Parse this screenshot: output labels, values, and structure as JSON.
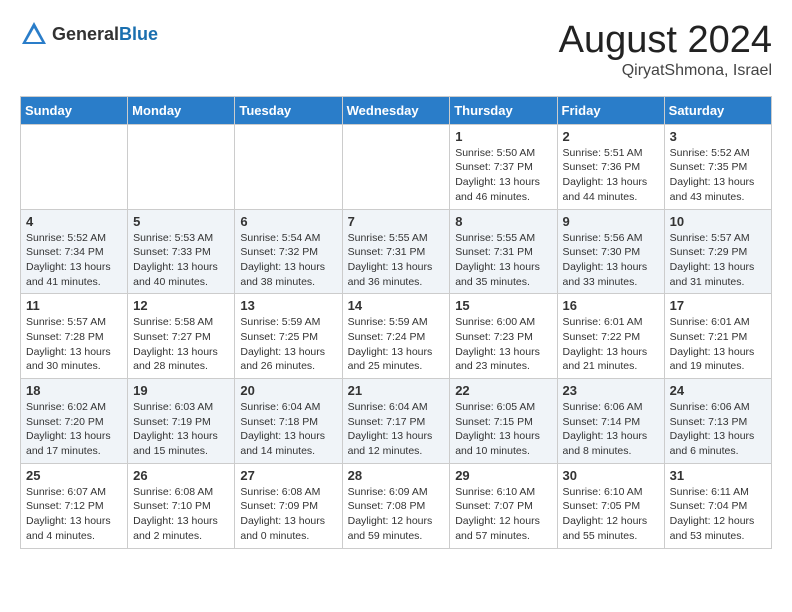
{
  "header": {
    "logo_general": "General",
    "logo_blue": "Blue",
    "title": "August 2024",
    "location": "QiryatShmona, Israel"
  },
  "weekdays": [
    "Sunday",
    "Monday",
    "Tuesday",
    "Wednesday",
    "Thursday",
    "Friday",
    "Saturday"
  ],
  "weeks": [
    [
      {
        "day": "",
        "sunrise": "",
        "sunset": "",
        "daylight": ""
      },
      {
        "day": "",
        "sunrise": "",
        "sunset": "",
        "daylight": ""
      },
      {
        "day": "",
        "sunrise": "",
        "sunset": "",
        "daylight": ""
      },
      {
        "day": "",
        "sunrise": "",
        "sunset": "",
        "daylight": ""
      },
      {
        "day": "1",
        "sunrise": "Sunrise: 5:50 AM",
        "sunset": "Sunset: 7:37 PM",
        "daylight": "Daylight: 13 hours and 46 minutes."
      },
      {
        "day": "2",
        "sunrise": "Sunrise: 5:51 AM",
        "sunset": "Sunset: 7:36 PM",
        "daylight": "Daylight: 13 hours and 44 minutes."
      },
      {
        "day": "3",
        "sunrise": "Sunrise: 5:52 AM",
        "sunset": "Sunset: 7:35 PM",
        "daylight": "Daylight: 13 hours and 43 minutes."
      }
    ],
    [
      {
        "day": "4",
        "sunrise": "Sunrise: 5:52 AM",
        "sunset": "Sunset: 7:34 PM",
        "daylight": "Daylight: 13 hours and 41 minutes."
      },
      {
        "day": "5",
        "sunrise": "Sunrise: 5:53 AM",
        "sunset": "Sunset: 7:33 PM",
        "daylight": "Daylight: 13 hours and 40 minutes."
      },
      {
        "day": "6",
        "sunrise": "Sunrise: 5:54 AM",
        "sunset": "Sunset: 7:32 PM",
        "daylight": "Daylight: 13 hours and 38 minutes."
      },
      {
        "day": "7",
        "sunrise": "Sunrise: 5:55 AM",
        "sunset": "Sunset: 7:31 PM",
        "daylight": "Daylight: 13 hours and 36 minutes."
      },
      {
        "day": "8",
        "sunrise": "Sunrise: 5:55 AM",
        "sunset": "Sunset: 7:31 PM",
        "daylight": "Daylight: 13 hours and 35 minutes."
      },
      {
        "day": "9",
        "sunrise": "Sunrise: 5:56 AM",
        "sunset": "Sunset: 7:30 PM",
        "daylight": "Daylight: 13 hours and 33 minutes."
      },
      {
        "day": "10",
        "sunrise": "Sunrise: 5:57 AM",
        "sunset": "Sunset: 7:29 PM",
        "daylight": "Daylight: 13 hours and 31 minutes."
      }
    ],
    [
      {
        "day": "11",
        "sunrise": "Sunrise: 5:57 AM",
        "sunset": "Sunset: 7:28 PM",
        "daylight": "Daylight: 13 hours and 30 minutes."
      },
      {
        "day": "12",
        "sunrise": "Sunrise: 5:58 AM",
        "sunset": "Sunset: 7:27 PM",
        "daylight": "Daylight: 13 hours and 28 minutes."
      },
      {
        "day": "13",
        "sunrise": "Sunrise: 5:59 AM",
        "sunset": "Sunset: 7:25 PM",
        "daylight": "Daylight: 13 hours and 26 minutes."
      },
      {
        "day": "14",
        "sunrise": "Sunrise: 5:59 AM",
        "sunset": "Sunset: 7:24 PM",
        "daylight": "Daylight: 13 hours and 25 minutes."
      },
      {
        "day": "15",
        "sunrise": "Sunrise: 6:00 AM",
        "sunset": "Sunset: 7:23 PM",
        "daylight": "Daylight: 13 hours and 23 minutes."
      },
      {
        "day": "16",
        "sunrise": "Sunrise: 6:01 AM",
        "sunset": "Sunset: 7:22 PM",
        "daylight": "Daylight: 13 hours and 21 minutes."
      },
      {
        "day": "17",
        "sunrise": "Sunrise: 6:01 AM",
        "sunset": "Sunset: 7:21 PM",
        "daylight": "Daylight: 13 hours and 19 minutes."
      }
    ],
    [
      {
        "day": "18",
        "sunrise": "Sunrise: 6:02 AM",
        "sunset": "Sunset: 7:20 PM",
        "daylight": "Daylight: 13 hours and 17 minutes."
      },
      {
        "day": "19",
        "sunrise": "Sunrise: 6:03 AM",
        "sunset": "Sunset: 7:19 PM",
        "daylight": "Daylight: 13 hours and 15 minutes."
      },
      {
        "day": "20",
        "sunrise": "Sunrise: 6:04 AM",
        "sunset": "Sunset: 7:18 PM",
        "daylight": "Daylight: 13 hours and 14 minutes."
      },
      {
        "day": "21",
        "sunrise": "Sunrise: 6:04 AM",
        "sunset": "Sunset: 7:17 PM",
        "daylight": "Daylight: 13 hours and 12 minutes."
      },
      {
        "day": "22",
        "sunrise": "Sunrise: 6:05 AM",
        "sunset": "Sunset: 7:15 PM",
        "daylight": "Daylight: 13 hours and 10 minutes."
      },
      {
        "day": "23",
        "sunrise": "Sunrise: 6:06 AM",
        "sunset": "Sunset: 7:14 PM",
        "daylight": "Daylight: 13 hours and 8 minutes."
      },
      {
        "day": "24",
        "sunrise": "Sunrise: 6:06 AM",
        "sunset": "Sunset: 7:13 PM",
        "daylight": "Daylight: 13 hours and 6 minutes."
      }
    ],
    [
      {
        "day": "25",
        "sunrise": "Sunrise: 6:07 AM",
        "sunset": "Sunset: 7:12 PM",
        "daylight": "Daylight: 13 hours and 4 minutes."
      },
      {
        "day": "26",
        "sunrise": "Sunrise: 6:08 AM",
        "sunset": "Sunset: 7:10 PM",
        "daylight": "Daylight: 13 hours and 2 minutes."
      },
      {
        "day": "27",
        "sunrise": "Sunrise: 6:08 AM",
        "sunset": "Sunset: 7:09 PM",
        "daylight": "Daylight: 13 hours and 0 minutes."
      },
      {
        "day": "28",
        "sunrise": "Sunrise: 6:09 AM",
        "sunset": "Sunset: 7:08 PM",
        "daylight": "Daylight: 12 hours and 59 minutes."
      },
      {
        "day": "29",
        "sunrise": "Sunrise: 6:10 AM",
        "sunset": "Sunset: 7:07 PM",
        "daylight": "Daylight: 12 hours and 57 minutes."
      },
      {
        "day": "30",
        "sunrise": "Sunrise: 6:10 AM",
        "sunset": "Sunset: 7:05 PM",
        "daylight": "Daylight: 12 hours and 55 minutes."
      },
      {
        "day": "31",
        "sunrise": "Sunrise: 6:11 AM",
        "sunset": "Sunset: 7:04 PM",
        "daylight": "Daylight: 12 hours and 53 minutes."
      }
    ]
  ]
}
